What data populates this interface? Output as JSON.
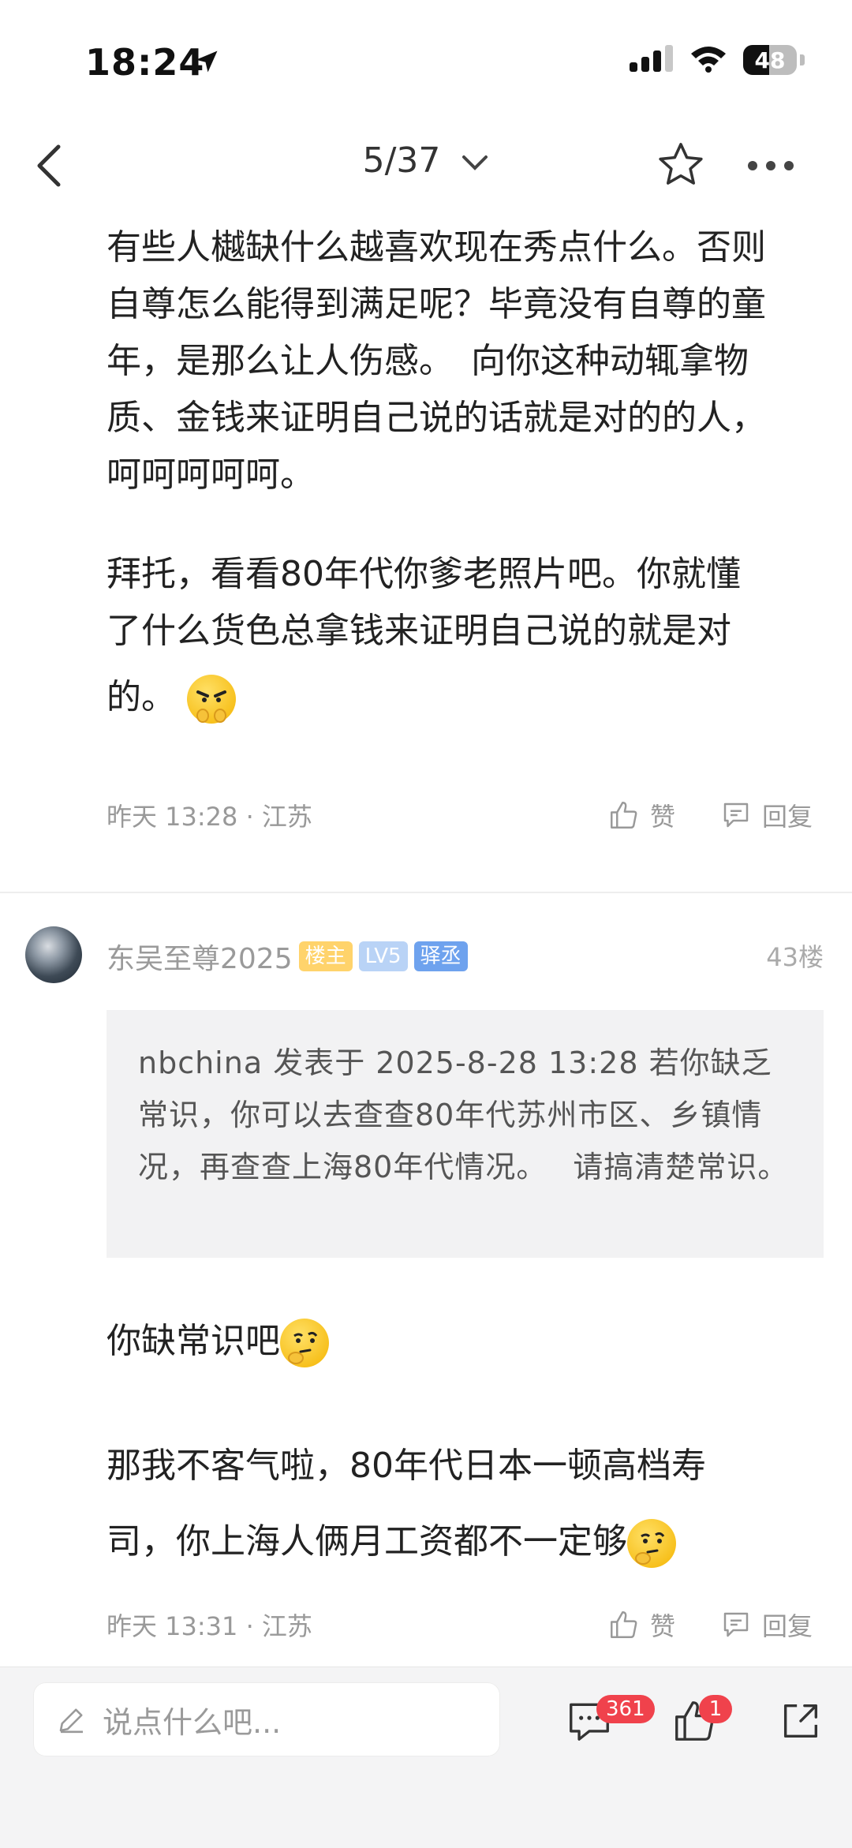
{
  "status": {
    "time": "18:24",
    "battery": "48"
  },
  "nav": {
    "title": "5/37"
  },
  "post1": {
    "para1": "有些人樾缺什么越喜欢现在秀点什么。否则自尊怎么能得到满足呢？毕竟没有自尊的童年，是那么让人伤感。　向你这种动辄拿物质、金钱来证明自己说的话就是对的的人，呵呵呵呵呵。",
    "para2_lines": [
      "拜托，看看80年代你爹老照片吧。你就懂",
      "了什么货色总拿钱来证明自己说的就是对",
      "的。"
    ],
    "meta": "昨天 13:28 · 江苏",
    "like": "赞",
    "reply": "回复"
  },
  "post2": {
    "username": "东吴至尊2025",
    "badges": {
      "host": "楼主",
      "level": "LV5",
      "role": "驿丞"
    },
    "floor": "43楼",
    "quote": "nbchina 发表于 2025-8-28 13:28 若你缺乏常识，你可以去查查80年代苏州市区、乡镇情况，再查查上海80年代情况。　 请搞清楚常识。",
    "line1": "你缺常识吧",
    "line2a": "那我不客气啦，80年代日本一顿高档寿",
    "line2b": "司，你上海人俩月工资都不一定够",
    "meta": "昨天 13:31 · 江苏",
    "like": "赞",
    "reply": "回复"
  },
  "bottom": {
    "input_placeholder": "说点什么吧...",
    "comment_count": "361",
    "like_count": "1"
  }
}
